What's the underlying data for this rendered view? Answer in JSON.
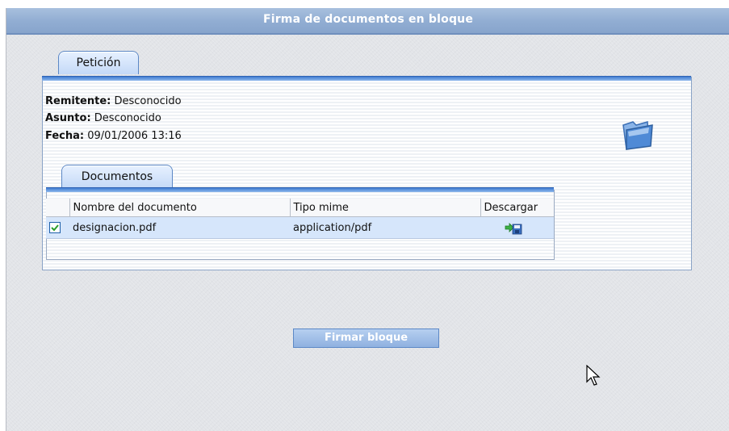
{
  "window": {
    "title": "Firma de documentos en bloque"
  },
  "peticion": {
    "tab_label": "Petición",
    "fields": [
      {
        "label": "Remitente:",
        "value": "Desconocido"
      },
      {
        "label": "Asunto:",
        "value": "Desconocido"
      },
      {
        "label": "Fecha:",
        "value": "09/01/2006 13:16"
      }
    ],
    "folder_icon": "open-folder-icon"
  },
  "documentos": {
    "tab_label": "Documentos",
    "columns": [
      "",
      "Nombre del documento",
      "Tipo mime",
      "Descargar"
    ],
    "rows": [
      {
        "checked": true,
        "name": "designacion.pdf",
        "mime": "application/pdf",
        "download_icon": "download-save-icon"
      }
    ]
  },
  "actions": {
    "firmar_label": "Firmar bloque"
  },
  "colors": {
    "accent": "#5c88c6",
    "titlebar": "#92aed3",
    "selected_row": "#d6e6fb"
  }
}
